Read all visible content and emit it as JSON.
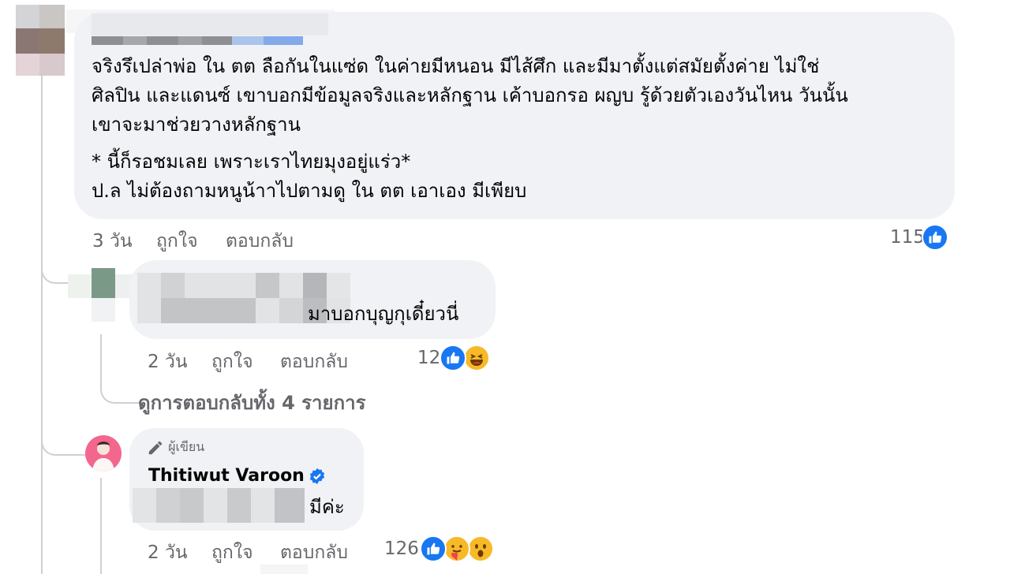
{
  "main_comment": {
    "paragraph1": [
      "จริงรึเปล่าพ่อ ใน ตต ลือกันในแซ่ด ในค่ายมีหนอน มีไส้ศึก และมีมาตั้งแต่สมัยตั้งค่าย ไม่ใช่",
      "ศิลปิน และแดนซ์ เขาบอกมีข้อมูลจริงและหลักฐาน เค้าบอกรอ ผญบ รู้ด้วยตัวเองวันไหน วันนั้น",
      "เขาจะมาช่วยวางหลักฐาน"
    ],
    "paragraph2": [
      "* นี้ก็รอชมเลย เพราะเราไทยมุงอยู่แร่ว*",
      "ป.ล ไม่ต้องถามหนูน้าาไปตามดู ใน ตต เอาเอง มีเพียบ"
    ],
    "time": "3 วัน",
    "like_label": "ถูกใจ",
    "reply_label": "ตอบกลับ",
    "reaction_count": "115"
  },
  "reply1": {
    "text": "มาบอกบุญกุเดี๋ยวนี่",
    "time": "2 วัน",
    "like_label": "ถูกใจ",
    "reply_label": "ตอบกลับ",
    "reaction_count": "12",
    "view_replies": "ดูการตอบกลับทั้ง 4 รายการ"
  },
  "reply2": {
    "author_badge": "ผู้เขียน",
    "author": "Thitiwut Varoon",
    "text": "มีค่ะ",
    "time": "2 วัน",
    "like_label": "ถูกใจ",
    "reply_label": "ตอบกลับ",
    "reaction_count": "126"
  },
  "colors": {
    "bubble": "#f0f2f5",
    "meta_text": "#65676b",
    "like_blue": "#1877f2",
    "verified_blue": "#1877f2"
  }
}
